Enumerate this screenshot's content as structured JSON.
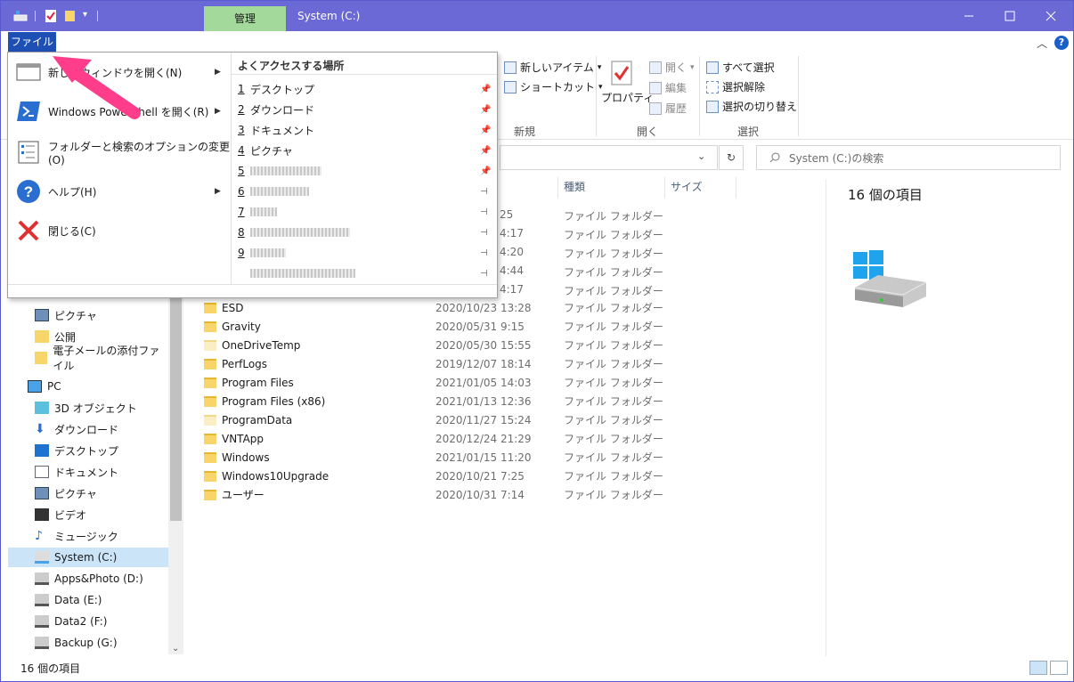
{
  "titlebar": {
    "manage_tab": "管理",
    "title": "System (C:)"
  },
  "ribbon": {
    "file_tab": "ファイル",
    "new_item": "新しいアイテム",
    "shortcut": "ショートカット",
    "group_new": "新規",
    "properties": "プロパティ",
    "open": "開く",
    "edit": "編集",
    "history": "履歴",
    "group_open": "開く",
    "select_all": "すべて選択",
    "select_none": "選択解除",
    "invert_selection": "選択の切り替え",
    "group_select": "選択"
  },
  "search": {
    "placeholder": "System (C:)の検索"
  },
  "filemenu": {
    "items": [
      {
        "label": "新しいウィンドウを開く(N)"
      },
      {
        "label": "Windows PowerShell を開く(R)"
      },
      {
        "label": "フォルダーと検索のオプションの変更(O)"
      },
      {
        "label": "ヘルプ(H)"
      },
      {
        "label": "閉じる(C)"
      }
    ],
    "recent_header": "よくアクセスする場所",
    "recent": [
      {
        "num": "1",
        "label": "デスクトップ"
      },
      {
        "num": "2",
        "label": "ダウンロード"
      },
      {
        "num": "3",
        "label": "ドキュメント"
      },
      {
        "num": "4",
        "label": "ピクチャ"
      },
      {
        "num": "5",
        "label": ""
      },
      {
        "num": "6",
        "label": ""
      },
      {
        "num": "7",
        "label": ""
      },
      {
        "num": "8",
        "label": ""
      },
      {
        "num": "9",
        "label": ""
      },
      {
        "num": "",
        "label": ""
      }
    ]
  },
  "nav": {
    "items": [
      {
        "label": "ピクチャ"
      },
      {
        "label": "公開"
      },
      {
        "label": "電子メールの添付ファイル"
      },
      {
        "label": "PC"
      },
      {
        "label": "3D オブジェクト"
      },
      {
        "label": "ダウンロード"
      },
      {
        "label": "デスクトップ"
      },
      {
        "label": "ドキュメント"
      },
      {
        "label": "ピクチャ"
      },
      {
        "label": "ビデオ"
      },
      {
        "label": "ミュージック"
      },
      {
        "label": "System (C:)"
      },
      {
        "label": "Apps&Photo (D:)"
      },
      {
        "label": "Data (E:)"
      },
      {
        "label": "Data2 (F:)"
      },
      {
        "label": "Backup (G:)"
      }
    ]
  },
  "columns": {
    "type": "種類",
    "size": "サイズ"
  },
  "hidden_rows": [
    {
      "date": "25",
      "type": "ファイル フォルダー"
    },
    {
      "date": "4:17",
      "type": "ファイル フォルダー"
    },
    {
      "date": "4:20",
      "type": "ファイル フォルダー"
    },
    {
      "date": "4:44",
      "type": "ファイル フォルダー"
    },
    {
      "date": "4:17",
      "type": "ファイル フォルダー"
    }
  ],
  "files": [
    {
      "name": "ESD",
      "date": "2020/10/23 13:28",
      "type": "ファイル フォルダー"
    },
    {
      "name": "Gravity",
      "date": "2020/05/31 9:15",
      "type": "ファイル フォルダー"
    },
    {
      "name": "OneDriveTemp",
      "date": "2020/05/30 15:55",
      "type": "ファイル フォルダー"
    },
    {
      "name": "PerfLogs",
      "date": "2019/12/07 18:14",
      "type": "ファイル フォルダー"
    },
    {
      "name": "Program Files",
      "date": "2021/01/05 14:03",
      "type": "ファイル フォルダー"
    },
    {
      "name": "Program Files (x86)",
      "date": "2021/01/13 12:36",
      "type": "ファイル フォルダー"
    },
    {
      "name": "ProgramData",
      "date": "2020/11/27 15:24",
      "type": "ファイル フォルダー"
    },
    {
      "name": "VNTApp",
      "date": "2020/12/24 21:29",
      "type": "ファイル フォルダー"
    },
    {
      "name": "Windows",
      "date": "2021/01/15 11:20",
      "type": "ファイル フォルダー"
    },
    {
      "name": "Windows10Upgrade",
      "date": "2020/10/21 7:25",
      "type": "ファイル フォルダー"
    },
    {
      "name": "ユーザー",
      "date": "2020/10/31 7:14",
      "type": "ファイル フォルダー"
    }
  ],
  "details": {
    "count": "16 個の項目"
  },
  "status": {
    "count": "16 個の項目"
  }
}
